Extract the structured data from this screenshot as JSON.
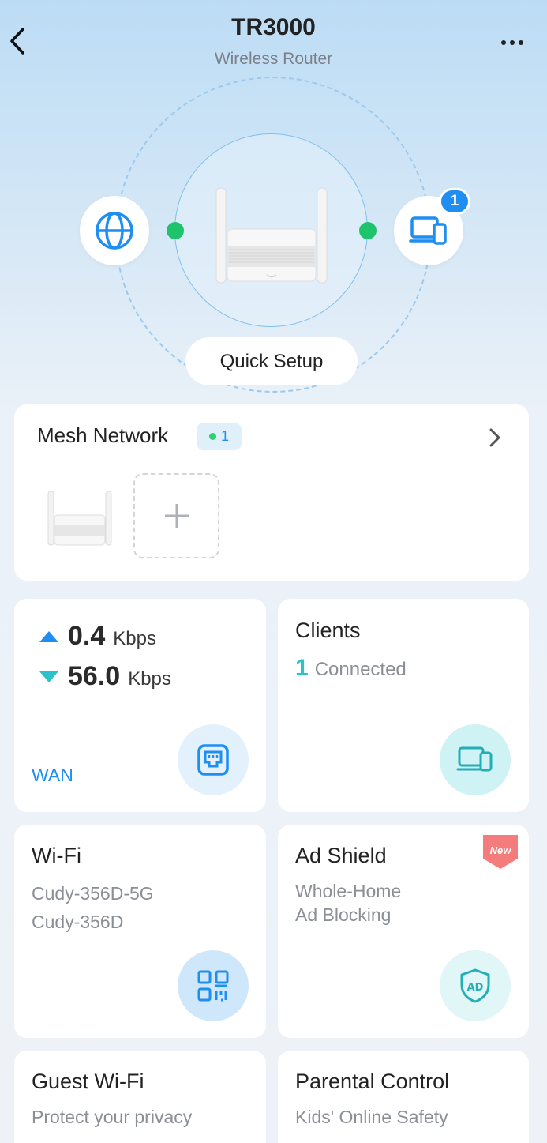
{
  "header": {
    "title": "TR3000",
    "subtitle": "Wireless Router"
  },
  "topology": {
    "clients_badge": "1",
    "quick_setup_label": "Quick Setup",
    "link_status_color": "#1ec46b"
  },
  "mesh": {
    "title": "Mesh Network",
    "online_count": "1"
  },
  "wan": {
    "upload_value": "0.4",
    "upload_unit": "Kbps",
    "download_value": "56.0",
    "download_unit": "Kbps",
    "label": "WAN"
  },
  "clients": {
    "title": "Clients",
    "count": "1",
    "status": "Connected"
  },
  "wifi": {
    "title": "Wi-Fi",
    "ssids": [
      "Cudy-356D-5G",
      "Cudy-356D"
    ]
  },
  "ad_shield": {
    "title": "Ad Shield",
    "subtitle_line1": "Whole-Home",
    "subtitle_line2": "Ad Blocking",
    "new_tag": "New"
  },
  "guest_wifi": {
    "title": "Guest Wi-Fi",
    "subtitle": "Protect your privacy"
  },
  "parental_control": {
    "title": "Parental Control",
    "subtitle": "Kids' Online Safety"
  },
  "colors": {
    "accent_blue": "#1f8ef1",
    "accent_teal": "#2bc3c9",
    "online_green": "#1ec46b"
  },
  "icons": [
    "back-arrow-icon",
    "more-icon",
    "globe-icon",
    "devices-icon",
    "chevron-right-icon",
    "plus-icon",
    "upload-arrow-icon",
    "download-arrow-icon",
    "ethernet-port-icon",
    "laptop-phone-icon",
    "qr-code-icon",
    "ad-shield-icon"
  ]
}
